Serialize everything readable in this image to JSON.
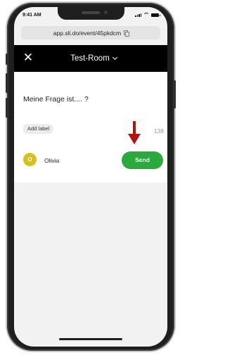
{
  "status_bar": {
    "time": "9:41 AM"
  },
  "browser": {
    "url": "app.sli.do/event/45pkdcm"
  },
  "header": {
    "room_title": "Test-Room"
  },
  "question": {
    "text": "Meine Frage ist.... ?",
    "add_label": "Add label",
    "char_count": "138"
  },
  "user": {
    "avatar_initial": "O",
    "name": "Olivia"
  },
  "send_label": "Send",
  "colors": {
    "header_bg": "#000000",
    "send_button": "#2aa93c",
    "avatar": "#d8c21a",
    "arrow": "#b01515"
  },
  "icons": [
    "close-icon",
    "chevron-down-icon",
    "copy-icon",
    "arrow-down-icon"
  ]
}
